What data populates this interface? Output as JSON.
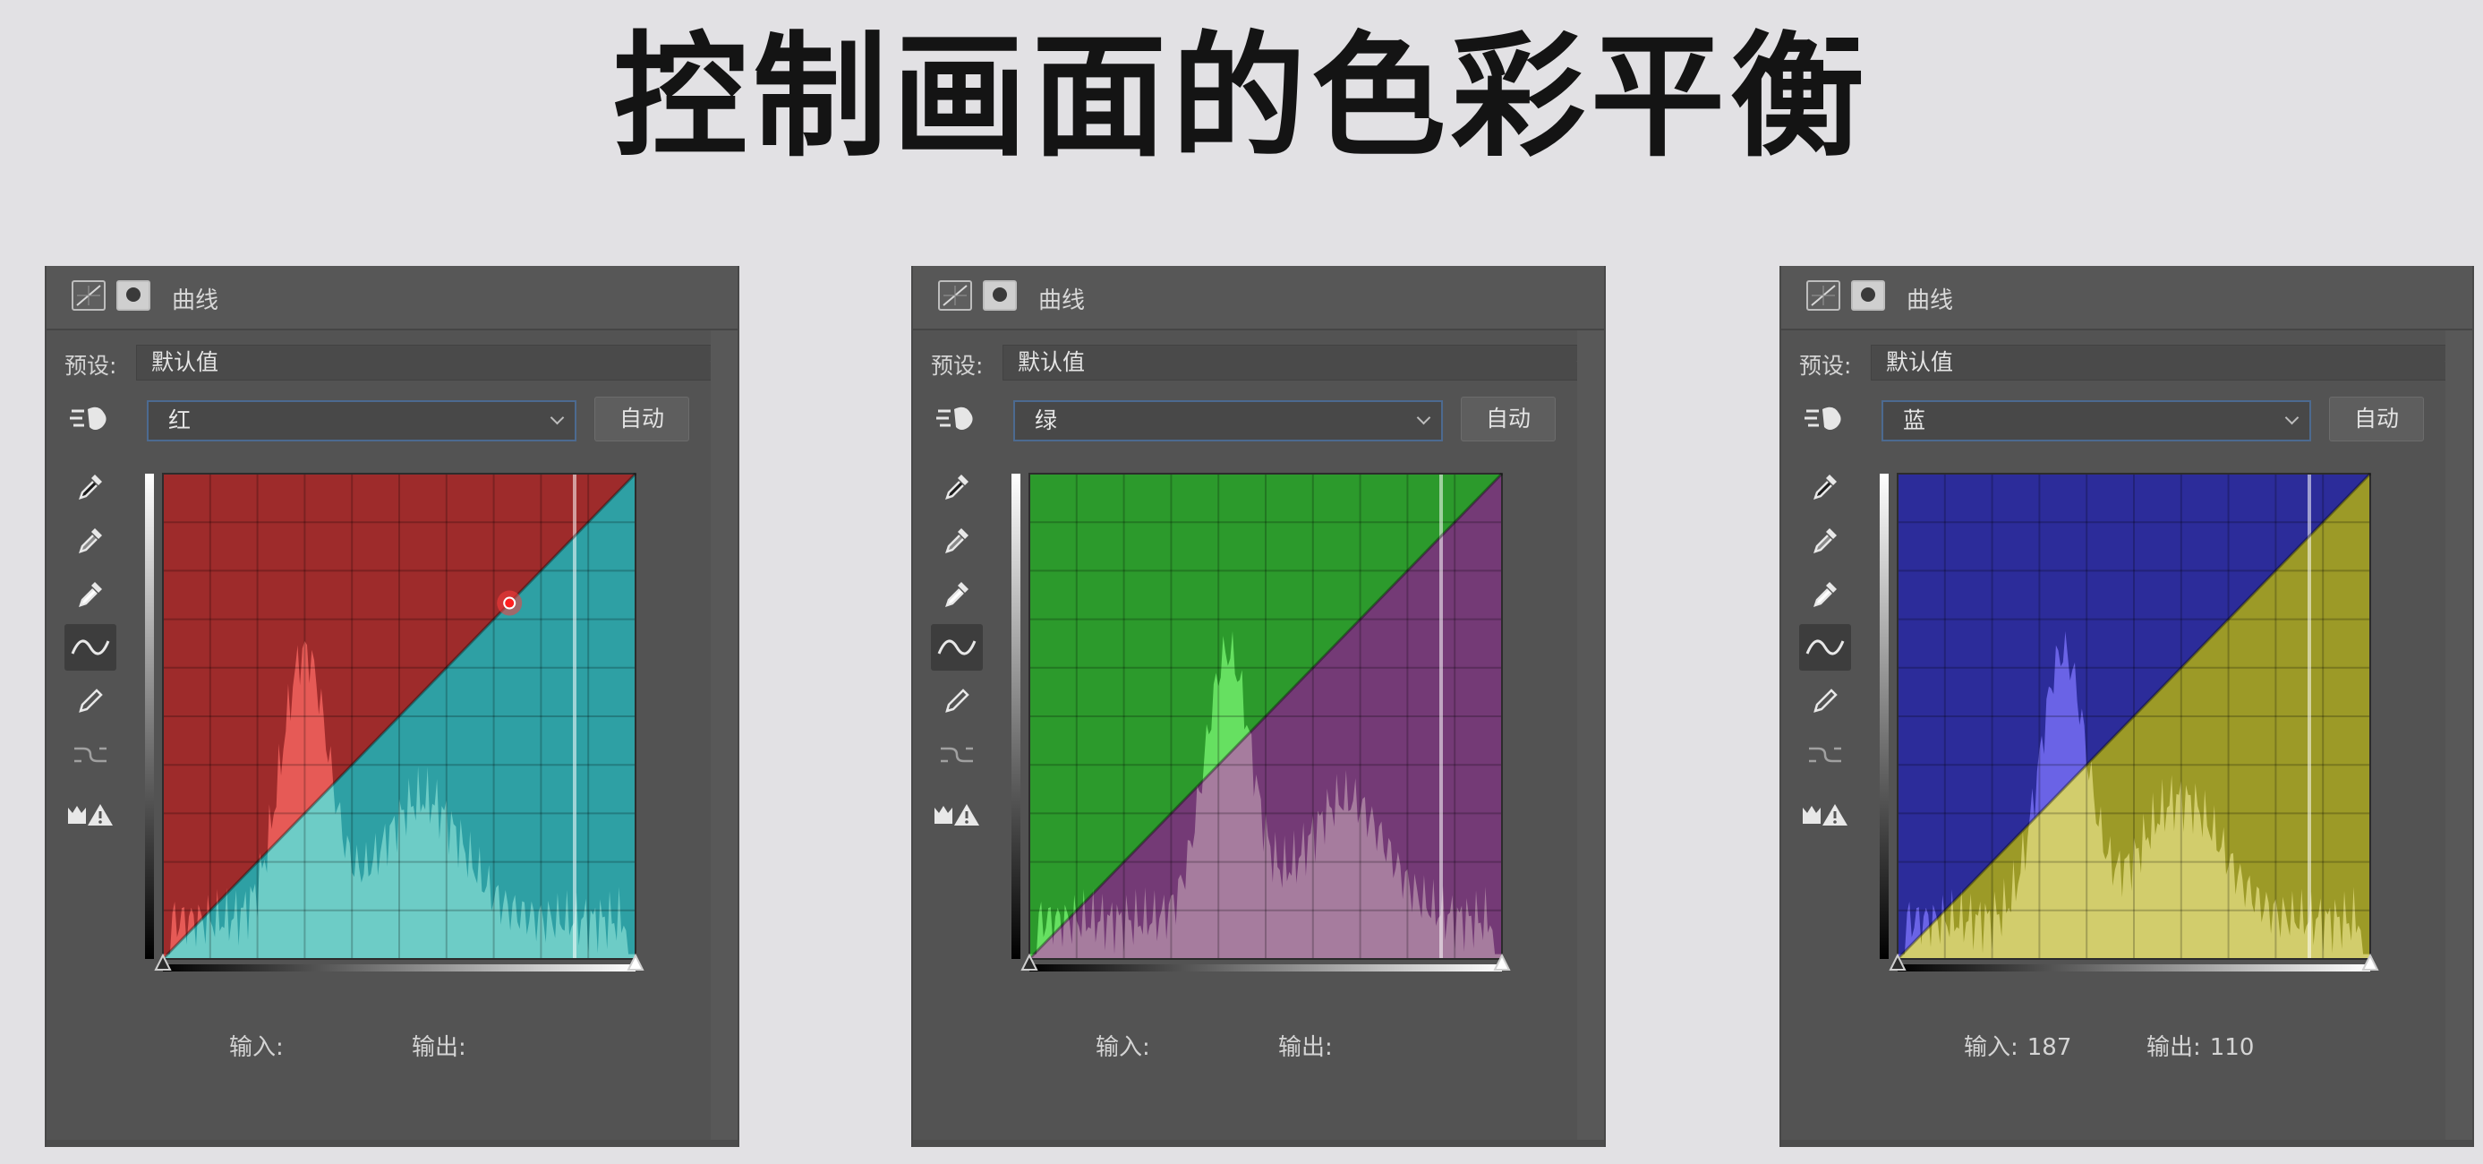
{
  "page_title": "控制画面的色彩平衡",
  "panels": [
    {
      "header_title": "曲线",
      "preset_label": "预设:",
      "preset_value": "默认值",
      "channel_value": "红",
      "auto_label": "自动",
      "input_label": "输入:",
      "input_value": "",
      "output_label": "输出:",
      "output_value": "",
      "colors": {
        "upper": "#9e2b2b",
        "lower": "#2ea0a4",
        "hist_upper": "#e65a56",
        "hist_lower": "#6dccc6"
      },
      "control_point": {
        "input": 187,
        "output": 187
      },
      "histogram_peak_at": 0.3
    },
    {
      "header_title": "曲线",
      "preset_label": "预设:",
      "preset_value": "默认值",
      "channel_value": "绿",
      "auto_label": "自动",
      "input_label": "输入:",
      "input_value": "",
      "output_label": "输出:",
      "output_value": "",
      "colors": {
        "upper": "#2c9a2c",
        "lower": "#743a76",
        "hist_upper": "#66e061",
        "hist_lower": "#a67c9e"
      },
      "histogram_peak_at": 0.42
    },
    {
      "header_title": "曲线",
      "preset_label": "预设:",
      "preset_value": "默认值",
      "channel_value": "蓝",
      "auto_label": "自动",
      "input_label": "输入:",
      "input_value": "187",
      "output_label": "输出:",
      "output_value": "110",
      "colors": {
        "upper": "#2c2c9a",
        "lower": "#9c9a27",
        "hist_upper": "#6a63e6",
        "hist_lower": "#d2cd6c"
      },
      "histogram_peak_at": 0.35
    }
  ]
}
